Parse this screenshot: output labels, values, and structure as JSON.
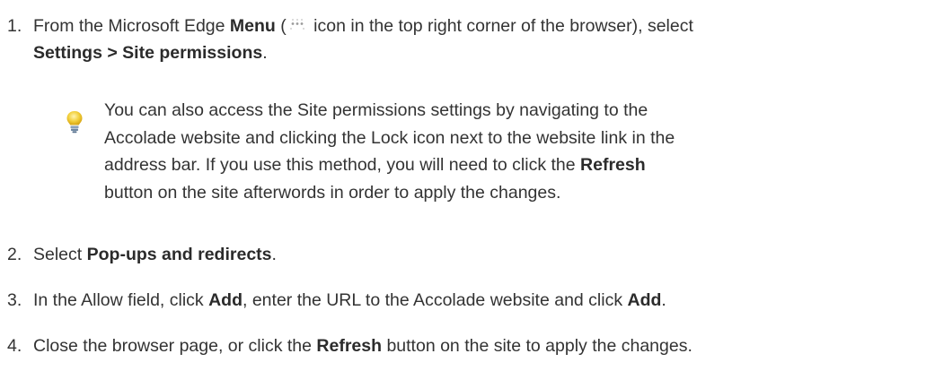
{
  "steps": [
    {
      "number": "1.",
      "text_pre": "From the Microsoft Edge ",
      "menu_label": "Menu",
      "text_paren_open": " (",
      "icon": "ellipsis-menu-icon",
      "text_after_icon": " icon in the top right corner of the browser), select",
      "settings_path": "Settings > Site permissions",
      "text_end": "."
    },
    {
      "number": "2.",
      "text_pre": "Select ",
      "bold": "Pop-ups and redirects",
      "text_end": "."
    },
    {
      "number": "3.",
      "text_pre": "In the Allow field, click ",
      "bold1": "Add",
      "text_mid": ", enter the URL to the Accolade website and click ",
      "bold2": "Add",
      "text_end": "."
    },
    {
      "number": "4.",
      "text_pre": "Close the browser page, or click the ",
      "bold": "Refresh",
      "text_end": " button on the site to apply the changes."
    }
  ],
  "tip": {
    "icon": "lightbulb-icon",
    "text_pre": "You can also access the Site permissions settings by navigating to the Accolade website and clicking the Lock icon next to the website link in the address bar. If you use this method, you will need to click the ",
    "bold": "Refresh",
    "text_end": " button on the site afterwords in order to apply the changes."
  },
  "colors": {
    "text": "#333333",
    "bulb": "#f2cf3a"
  }
}
